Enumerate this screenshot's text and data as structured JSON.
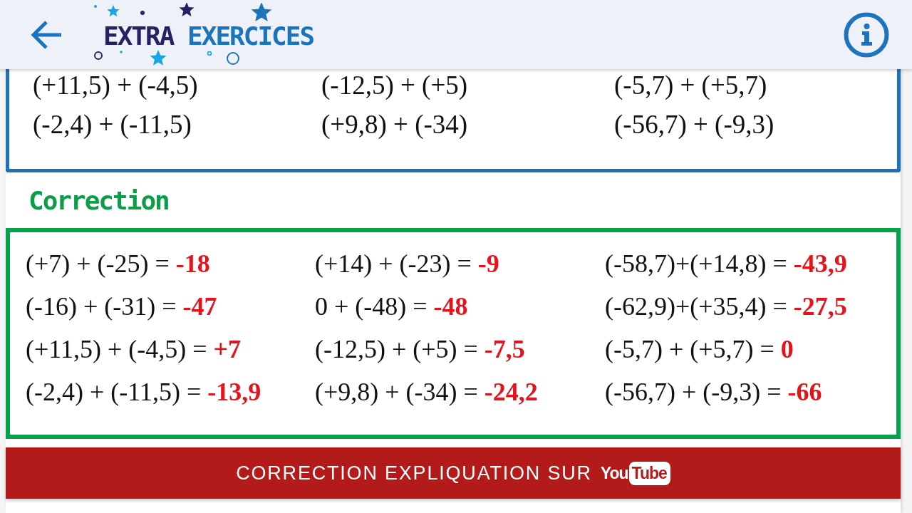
{
  "header": {
    "logo_words": [
      "EXTRA",
      "EXERCICES"
    ]
  },
  "exercises": {
    "rows": [
      [
        "(+11,5) + (-4,5)",
        "(-12,5) + (+5)",
        "(-5,7) + (+5,7)"
      ],
      [
        "(-2,4) + (-11,5)",
        "(+9,8) + (-34)",
        "(-56,7) + (-9,3)"
      ]
    ]
  },
  "correction": {
    "title": "Correction",
    "rows": [
      [
        {
          "expression": "(+7) + (-25) =",
          "result": "-18"
        },
        {
          "expression": "(+14) + (-23) =",
          "result": "-9"
        },
        {
          "expression": "(-58,7)+(+14,8) =",
          "result": "-43,9"
        }
      ],
      [
        {
          "expression": "(-16) + (-31) =",
          "result": "-47"
        },
        {
          "expression": "0 + (-48) =",
          "result": "-48"
        },
        {
          "expression": "(-62,9)+(+35,4) =",
          "result": "-27,5"
        }
      ],
      [
        {
          "expression": "(+11,5) + (-4,5) =",
          "result": "+7"
        },
        {
          "expression": "(-12,5) + (+5) =",
          "result": "-7,5"
        },
        {
          "expression": "(-5,7) + (+5,7) =",
          "result": "0"
        }
      ],
      [
        {
          "expression": "(-2,4) + (-11,5) =",
          "result": "-13,9"
        },
        {
          "expression": "(+9,8) + (-34) =",
          "result": "-24,2"
        },
        {
          "expression": "(-56,7) + (-9,3) =",
          "result": "-66"
        }
      ]
    ]
  },
  "video_button": {
    "label": "CORRECTION EXPLIQUATION SUR",
    "logo": [
      "You",
      "Tube"
    ]
  }
}
